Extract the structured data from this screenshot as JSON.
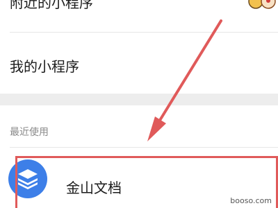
{
  "list": {
    "nearby_label": "附近的小程序",
    "mine_label": "我的小程序"
  },
  "recent": {
    "header": "最近使用",
    "items": [
      {
        "name": "金山文档",
        "icon": "stacked-layers-icon"
      }
    ]
  },
  "annotation": {
    "color": "#e05a5a",
    "arrow": "red-arrow-pointing-to-recent-item"
  },
  "watermark": "booso.com",
  "colors": {
    "app_icon": "#3d7fe8",
    "highlight": "#e05a5a"
  }
}
